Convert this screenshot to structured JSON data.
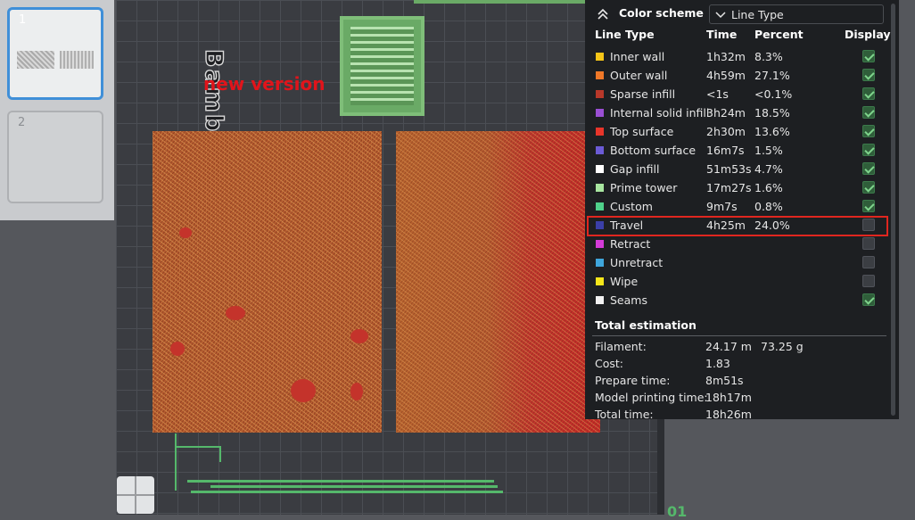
{
  "plates": [
    {
      "number": "1",
      "selected": true
    },
    {
      "number": "2",
      "selected": false
    }
  ],
  "plate": {
    "label": "Bambu Cool Plate",
    "annotation": "new version",
    "annotation_color": "#e1141b"
  },
  "panel": {
    "scheme_label": "Color scheme",
    "scheme_value": "Line Type",
    "columns": {
      "type": "Line Type",
      "time": "Time",
      "percent": "Percent",
      "display": "Display"
    },
    "rows": [
      {
        "name": "Inner wall",
        "time": "1h32m",
        "percent": "8.3%",
        "color": "#f5c518",
        "display": true
      },
      {
        "name": "Outer wall",
        "time": "4h59m",
        "percent": "27.1%",
        "color": "#f07828",
        "display": true
      },
      {
        "name": "Sparse infill",
        "time": "<1s",
        "percent": "<0.1%",
        "color": "#b8382a",
        "display": true
      },
      {
        "name": "Internal solid infill",
        "time": "3h24m",
        "percent": "18.5%",
        "color": "#9a4fd3",
        "display": true
      },
      {
        "name": "Top surface",
        "time": "2h30m",
        "percent": "13.6%",
        "color": "#e8352a",
        "display": true
      },
      {
        "name": "Bottom surface",
        "time": "16m7s",
        "percent": "1.5%",
        "color": "#6b5bd6",
        "display": true
      },
      {
        "name": "Gap infill",
        "time": "51m53s",
        "percent": "4.7%",
        "color": "#ffffff",
        "display": true
      },
      {
        "name": "Prime tower",
        "time": "17m27s",
        "percent": "1.6%",
        "color": "#a8e6a0",
        "display": true
      },
      {
        "name": "Custom",
        "time": "9m7s",
        "percent": "0.8%",
        "color": "#4fd18a",
        "display": true
      },
      {
        "name": "Travel",
        "time": "4h25m",
        "percent": "24.0%",
        "color": "#3b3fa8",
        "display": false,
        "highlighted": true
      },
      {
        "name": "Retract",
        "time": "",
        "percent": "",
        "color": "#d43bd8",
        "display": false
      },
      {
        "name": "Unretract",
        "time": "",
        "percent": "",
        "color": "#3fa6dc",
        "display": false
      },
      {
        "name": "Wipe",
        "time": "",
        "percent": "",
        "color": "#f5e61a",
        "display": false
      },
      {
        "name": "Seams",
        "time": "",
        "percent": "",
        "color": "#f2f2f2",
        "display": true
      }
    ],
    "estimation": {
      "title": "Total estimation",
      "filament_label": "Filament:",
      "filament_length": "24.17 m",
      "filament_weight": "73.25 g",
      "cost_label": "Cost:",
      "cost_value": "1.83",
      "prepare_label": "Prepare time:",
      "prepare_value": "8m51s",
      "model_label": "Model printing time:",
      "model_value": "18h17m",
      "total_label": "Total time:",
      "total_value": "18h26m"
    }
  },
  "bottom_mark": "01",
  "icons": {
    "collapse": "double-chevron-up-icon",
    "dropdown": "chevron-down-icon",
    "checkbox": "checkmark-icon"
  }
}
